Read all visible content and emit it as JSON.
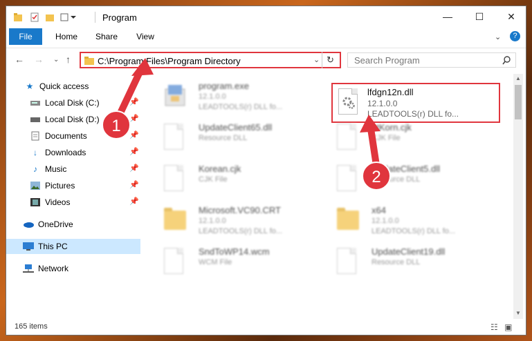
{
  "window": {
    "title": "Program",
    "controls": {
      "minimize": "—",
      "maximize": "☐",
      "close": "✕"
    }
  },
  "ribbon": {
    "tabs": [
      {
        "label": "File"
      },
      {
        "label": "Home"
      },
      {
        "label": "Share"
      },
      {
        "label": "View"
      }
    ]
  },
  "address": {
    "path": "C:\\Program Files\\Program Directory",
    "search_placeholder": "Search Program"
  },
  "nav": {
    "items": [
      {
        "label": "Quick access",
        "icon": "star-icon"
      },
      {
        "label": "Local Disk (C:)",
        "icon": "drive-icon"
      },
      {
        "label": "Local Disk (D:)",
        "icon": "drive-icon"
      },
      {
        "label": "Documents",
        "icon": "documents-icon"
      },
      {
        "label": "Downloads",
        "icon": "download-icon"
      },
      {
        "label": "Music",
        "icon": "music-icon"
      },
      {
        "label": "Pictures",
        "icon": "pictures-icon"
      },
      {
        "label": "Videos",
        "icon": "videos-icon"
      },
      {
        "label": "OneDrive",
        "icon": "cloud-icon"
      },
      {
        "label": "This PC",
        "icon": "computer-icon"
      },
      {
        "label": "Network",
        "icon": "network-icon"
      }
    ]
  },
  "files": [
    {
      "name": "program.exe",
      "line2": "12.1.0.0",
      "line3": "LEADTOOLS(r) DLL fo..."
    },
    {
      "name": "lfdgn12n.dll",
      "line2": "12.1.0.0",
      "line3": "LEADTOOLS(r) DLL fo..."
    },
    {
      "name": "UpdateClient65.dll",
      "line2": "Resource DLL"
    },
    {
      "name": "LtKorn.cjk",
      "line2": "CJK File"
    },
    {
      "name": "Korean.cjk",
      "line2": "CJK File"
    },
    {
      "name": "UpdateClient5.dll",
      "line2": "Resource DLL"
    },
    {
      "name": "Microsoft.VC90.CRT",
      "line2": "12.1.0.0",
      "line3": "LEADTOOLS(r) DLL fo..."
    },
    {
      "name": "x64",
      "line2": "12.1.0.0",
      "line3": "LEADTOOLS(r) DLL fo..."
    },
    {
      "name": "SndToWP14.wcm",
      "line2": "WCM File"
    },
    {
      "name": "UpdateClient19.dll",
      "line2": "Resource DLL"
    }
  ],
  "status": {
    "items": "165 items"
  },
  "callouts": {
    "one": "1",
    "two": "2"
  },
  "colors": {
    "accent": "#1979ca",
    "highlight": "#e0353d",
    "selected": "#cce8ff"
  }
}
